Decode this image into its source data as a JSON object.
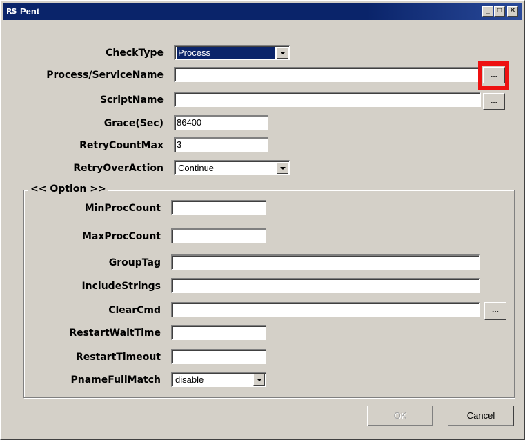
{
  "window": {
    "icon_text": "RS",
    "title": "Pent",
    "minimize": "_",
    "maximize": "□",
    "close": "✕"
  },
  "form": {
    "check_type": {
      "label": "CheckType",
      "value": "Process"
    },
    "process_service_name": {
      "label": "Process/ServiceName",
      "value": "",
      "browse": "..."
    },
    "script_name": {
      "label": "ScriptName",
      "value": "",
      "browse": "..."
    },
    "grace": {
      "label": "Grace(Sec)",
      "value": "86400"
    },
    "retry_count_max": {
      "label": "RetryCountMax",
      "value": "3"
    },
    "retry_over_action": {
      "label": "RetryOverAction",
      "value": "Continue"
    }
  },
  "option": {
    "title": "<< Option >>",
    "min_proc_count": {
      "label": "MinProcCount",
      "value": ""
    },
    "max_proc_count": {
      "label": "MaxProcCount",
      "value": ""
    },
    "group_tag": {
      "label": "GroupTag",
      "value": ""
    },
    "include_strings": {
      "label": "IncludeStrings",
      "value": ""
    },
    "clear_cmd": {
      "label": "ClearCmd",
      "value": "",
      "browse": "..."
    },
    "restart_wait_time": {
      "label": "RestartWaitTime",
      "value": ""
    },
    "restart_timeout": {
      "label": "RestartTimeout",
      "value": ""
    },
    "pname_full_match": {
      "label": "PnameFullMatch",
      "value": "disable"
    }
  },
  "buttons": {
    "ok": "OK",
    "cancel": "Cancel"
  },
  "colors": {
    "titlebar": "#0a246a",
    "face": "#d4d0c8",
    "highlight": "#ee1111"
  }
}
